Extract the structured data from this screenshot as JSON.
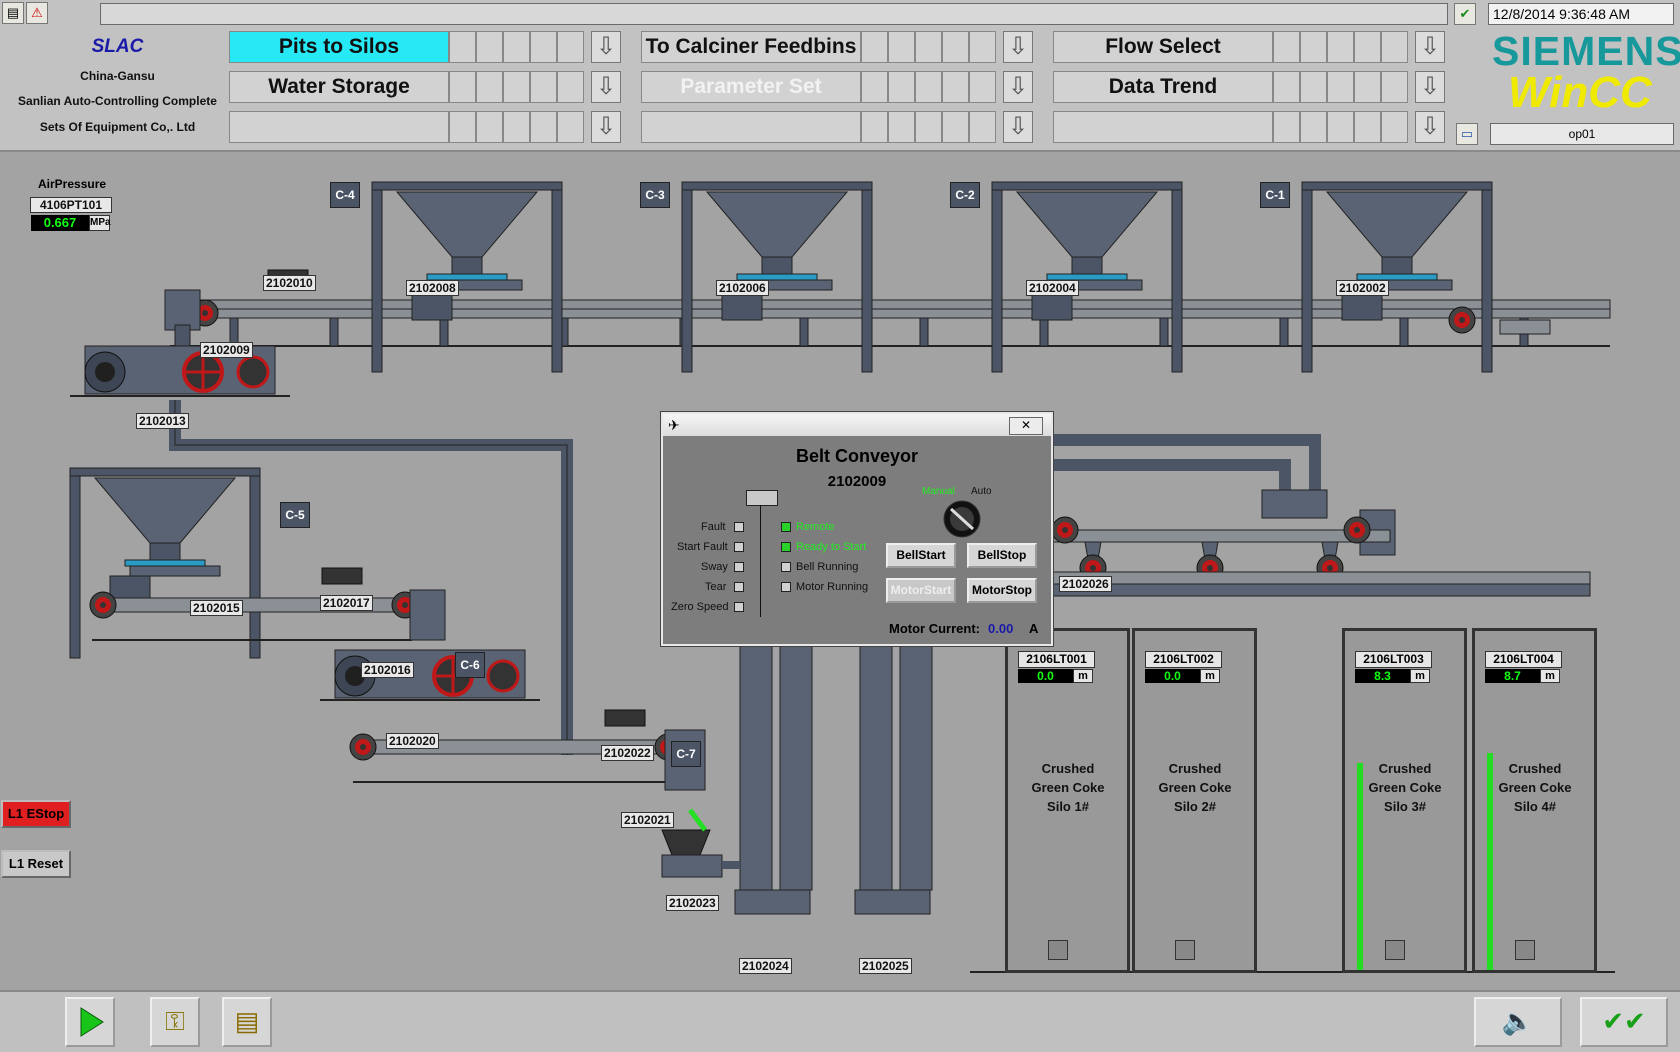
{
  "header": {
    "datetime": "12/8/2014 9:36:48 AM",
    "operator": "op01",
    "brand_top": "SIEMENS",
    "brand_bottom": "WinCC",
    "company": {
      "logo": "SLAC",
      "line1": "China-Gansu",
      "line2": "Sanlian  Auto-Controlling Complete",
      "line3": "Sets Of Equipment Co,. Ltd"
    },
    "nav": [
      {
        "label": "Pits to Silos",
        "state": "active"
      },
      {
        "label": "To Calciner Feedbins",
        "state": "normal"
      },
      {
        "label": "Flow Select",
        "state": "normal"
      },
      {
        "label": "Water Storage",
        "state": "normal"
      },
      {
        "label": "Parameter Set",
        "state": "disabled"
      },
      {
        "label": "Data Trend",
        "state": "normal"
      },
      {
        "label": "",
        "state": "normal"
      },
      {
        "label": "",
        "state": "normal"
      },
      {
        "label": "",
        "state": "normal"
      }
    ]
  },
  "pressure": {
    "title": "AirPressure",
    "tag": "4106PT101",
    "value": "0.667",
    "unit": "MPa"
  },
  "pits": [
    "C-4",
    "C-3",
    "C-2",
    "C-1",
    "C-5",
    "C-6",
    "C-7"
  ],
  "equipment": [
    "2102008",
    "2102006",
    "2102004",
    "2102002",
    "2102010",
    "2102009",
    "2102013",
    "2102015",
    "2102017",
    "2102016",
    "2102020",
    "2102022",
    "2102021",
    "2102023",
    "2102024",
    "2102025",
    "2102026"
  ],
  "silos": [
    {
      "tag": "2106LT001",
      "value": "0.0",
      "unit": "m",
      "name1": "Crushed",
      "name2": "Green Coke",
      "name3": "Silo 1#",
      "level": 0.0
    },
    {
      "tag": "2106LT002",
      "value": "0.0",
      "unit": "m",
      "name1": "Crushed",
      "name2": "Green Coke",
      "name3": "Silo 2#",
      "level": 0.0
    },
    {
      "tag": "2106LT003",
      "value": "8.3",
      "unit": "m",
      "name1": "Crushed",
      "name2": "Green Coke",
      "name3": "Silo 3#",
      "level": 0.61
    },
    {
      "tag": "2106LT004",
      "value": "8.7",
      "unit": "m",
      "name1": "Crushed",
      "name2": "Green Coke",
      "name3": "Silo 4#",
      "level": 0.64
    }
  ],
  "dialog": {
    "title": "Belt Conveyor",
    "id": "2102009",
    "faults": [
      "Fault",
      "Start Fault",
      "Sway",
      "Tear",
      "Zero Speed"
    ],
    "status": [
      "Remote",
      "Ready to Start",
      "Bell Running",
      "Motor Running"
    ],
    "status_on": [
      true,
      true,
      false,
      false
    ],
    "manual_label": "Manual",
    "auto_label": "Auto",
    "buttons": {
      "bell_start": "BellStart",
      "bell_stop": "BellStop",
      "motor_start": "MotorStart",
      "motor_stop": "MotorStop"
    },
    "current_label": "Motor Current:",
    "current_value": "0.00",
    "current_unit": "A"
  },
  "controls": {
    "estop": "L1 EStop",
    "reset": "L1 Reset"
  },
  "colors": {
    "active_nav": "#27e8f5",
    "estop": "#e02020",
    "value_green": "#13ff13",
    "manual_green": "#2bd12b",
    "equipment": "#4c5566"
  }
}
